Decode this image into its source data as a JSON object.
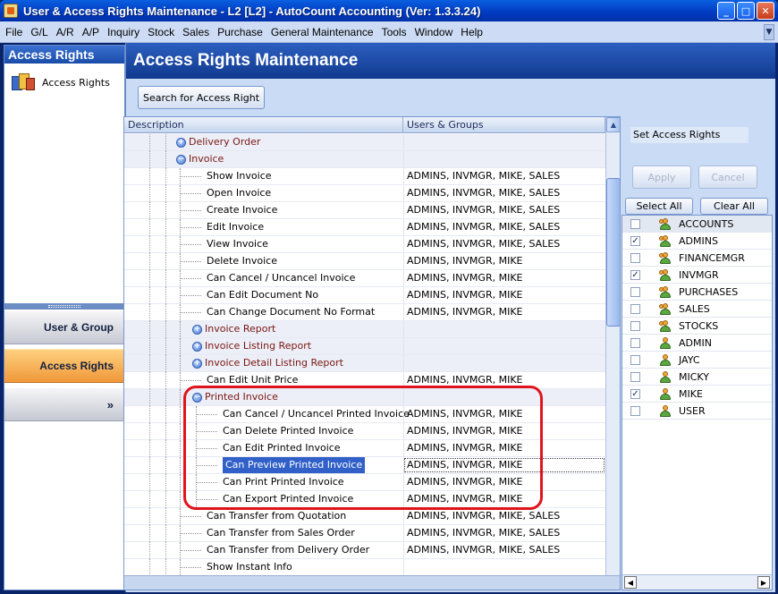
{
  "window": {
    "title": "User & Access Rights Maintenance - L2 [L2] - AutoCount Accounting (Ver: 1.3.3.24)",
    "minimize": "_",
    "maximize": "□",
    "close": "✕"
  },
  "menu": [
    "File",
    "G/L",
    "A/R",
    "A/P",
    "Inquiry",
    "Stock",
    "Sales",
    "Purchase",
    "General Maintenance",
    "Tools",
    "Window",
    "Help"
  ],
  "nav": {
    "header": "Access Rights",
    "link": "Access Rights",
    "buttons": {
      "user_group": "User & Group",
      "access_rights": "Access Rights",
      "more": "»"
    }
  },
  "main": {
    "title": "Access Rights Maintenance",
    "search_button": "Search for Access Right",
    "columns": {
      "description": "Description",
      "users": "Users & Groups"
    },
    "rows": [
      {
        "level": 0,
        "kind": "group",
        "toggle": "+",
        "desc": "Delivery Order",
        "users": ""
      },
      {
        "level": 0,
        "kind": "group",
        "toggle": "−",
        "desc": "Invoice",
        "users": ""
      },
      {
        "level": 1,
        "kind": "leaf",
        "desc": "Show Invoice",
        "users": "ADMINS, INVMGR, MIKE, SALES"
      },
      {
        "level": 1,
        "kind": "leaf",
        "desc": "Open Invoice",
        "users": "ADMINS, INVMGR, MIKE, SALES"
      },
      {
        "level": 1,
        "kind": "leaf",
        "desc": "Create Invoice",
        "users": "ADMINS, INVMGR, MIKE, SALES"
      },
      {
        "level": 1,
        "kind": "leaf",
        "desc": "Edit Invoice",
        "users": "ADMINS, INVMGR, MIKE, SALES"
      },
      {
        "level": 1,
        "kind": "leaf",
        "desc": "View Invoice",
        "users": "ADMINS, INVMGR, MIKE, SALES"
      },
      {
        "level": 1,
        "kind": "leaf",
        "desc": "Delete Invoice",
        "users": "ADMINS, INVMGR, MIKE"
      },
      {
        "level": 1,
        "kind": "leaf",
        "desc": "Can Cancel / Uncancel Invoice",
        "users": "ADMINS, INVMGR, MIKE"
      },
      {
        "level": 1,
        "kind": "leaf",
        "desc": "Can Edit Document No",
        "users": "ADMINS, INVMGR, MIKE"
      },
      {
        "level": 1,
        "kind": "leaf",
        "desc": "Can Change Document No Format",
        "users": "ADMINS, INVMGR, MIKE"
      },
      {
        "level": 1,
        "kind": "group",
        "toggle": "+",
        "desc": "Invoice Report",
        "users": ""
      },
      {
        "level": 1,
        "kind": "group",
        "toggle": "+",
        "desc": "Invoice Listing Report",
        "users": ""
      },
      {
        "level": 1,
        "kind": "group",
        "toggle": "+",
        "desc": "Invoice Detail Listing Report",
        "users": ""
      },
      {
        "level": 1,
        "kind": "leaf",
        "desc": "Can Edit Unit Price",
        "users": "ADMINS, INVMGR, MIKE"
      },
      {
        "level": 1,
        "kind": "group",
        "toggle": "−",
        "desc": "Printed Invoice",
        "users": ""
      },
      {
        "level": 2,
        "kind": "leaf",
        "desc": "Can Cancel / Uncancel Printed Invoice",
        "users": "ADMINS, INVMGR, MIKE"
      },
      {
        "level": 2,
        "kind": "leaf",
        "desc": "Can Delete Printed Invoice",
        "users": "ADMINS, INVMGR, MIKE"
      },
      {
        "level": 2,
        "kind": "leaf",
        "desc": "Can Edit Printed Invoice",
        "users": "ADMINS, INVMGR, MIKE"
      },
      {
        "level": 2,
        "kind": "leaf",
        "selected": true,
        "desc": "Can Preview Printed Invoice",
        "users": "ADMINS, INVMGR, MIKE"
      },
      {
        "level": 2,
        "kind": "leaf",
        "desc": "Can Print Printed Invoice",
        "users": "ADMINS, INVMGR, MIKE"
      },
      {
        "level": 2,
        "kind": "leaf",
        "desc": "Can Export Printed Invoice",
        "users": "ADMINS, INVMGR, MIKE"
      },
      {
        "level": 1,
        "kind": "leaf",
        "desc": "Can Transfer from Quotation",
        "users": "ADMINS, INVMGR, MIKE, SALES"
      },
      {
        "level": 1,
        "kind": "leaf",
        "desc": "Can Transfer from Sales Order",
        "users": "ADMINS, INVMGR, MIKE, SALES"
      },
      {
        "level": 1,
        "kind": "leaf",
        "desc": "Can Transfer from Delivery Order",
        "users": "ADMINS, INVMGR, MIKE, SALES"
      },
      {
        "level": 1,
        "kind": "leaf",
        "desc": "Show Instant Info",
        "users": ""
      }
    ]
  },
  "right": {
    "set_label": "Set Access Rights",
    "apply": "Apply",
    "cancel": "Cancel",
    "select_all": "Select All",
    "clear_all": "Clear All",
    "users": [
      {
        "name": "ACCOUNTS",
        "checked": false,
        "group": true
      },
      {
        "name": "ADMINS",
        "checked": true,
        "group": true
      },
      {
        "name": "FINANCEMGR",
        "checked": false,
        "group": true
      },
      {
        "name": "INVMGR",
        "checked": true,
        "group": true
      },
      {
        "name": "PURCHASES",
        "checked": false,
        "group": true
      },
      {
        "name": "SALES",
        "checked": false,
        "group": true
      },
      {
        "name": "STOCKS",
        "checked": false,
        "group": true
      },
      {
        "name": "ADMIN",
        "checked": false,
        "group": false
      },
      {
        "name": "JAYC",
        "checked": false,
        "group": false
      },
      {
        "name": "MICKY",
        "checked": false,
        "group": false
      },
      {
        "name": "MIKE",
        "checked": true,
        "group": false
      },
      {
        "name": "USER",
        "checked": false,
        "group": false
      }
    ]
  },
  "colors": {
    "titlebar": "#0039c0",
    "header": "#10398e",
    "selection": "#3160c8",
    "highlight": "#e0141c",
    "active_nav": "#f09838"
  }
}
